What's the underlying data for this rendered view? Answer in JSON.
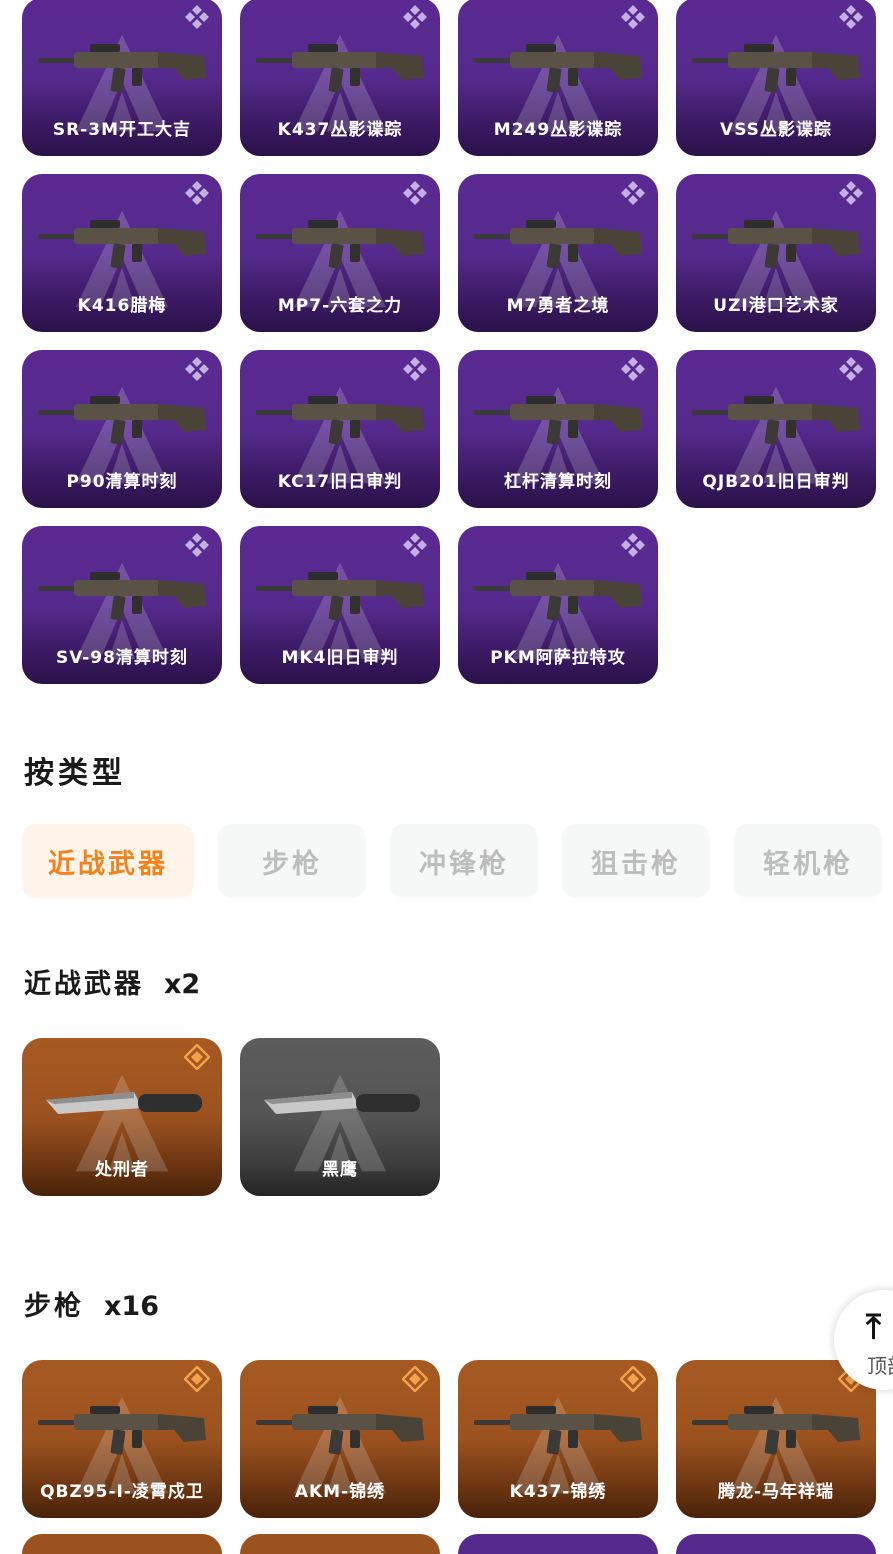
{
  "colors": {
    "purple": "#562a8c",
    "orange": "#9c521f",
    "gray": "#545454",
    "accent": "#f0831d"
  },
  "top_grid": [
    {
      "name": "SR-3M开工大吉",
      "rarity": "purple"
    },
    {
      "name": "K437丛影谍踪",
      "rarity": "purple"
    },
    {
      "name": "M249丛影谍踪",
      "rarity": "purple"
    },
    {
      "name": "VSS丛影谍踪",
      "rarity": "purple"
    },
    {
      "name": "K416腊梅",
      "rarity": "purple"
    },
    {
      "name": "MP7-六套之力",
      "rarity": "purple"
    },
    {
      "name": "M7勇者之境",
      "rarity": "purple"
    },
    {
      "name": "UZI港口艺术家",
      "rarity": "purple"
    },
    {
      "name": "P90清算时刻",
      "rarity": "purple"
    },
    {
      "name": "KC17旧日审判",
      "rarity": "purple"
    },
    {
      "name": "杠杆清算时刻",
      "rarity": "purple"
    },
    {
      "name": "QJB201旧日审判",
      "rarity": "purple"
    },
    {
      "name": "SV-98清算时刻",
      "rarity": "purple"
    },
    {
      "name": "MK4旧日审判",
      "rarity": "purple"
    },
    {
      "name": "PKM阿萨拉特攻",
      "rarity": "purple"
    }
  ],
  "by_type": {
    "title": "按类型",
    "tabs": [
      {
        "label": "近战武器",
        "active": true
      },
      {
        "label": "步枪",
        "active": false
      },
      {
        "label": "冲锋枪",
        "active": false
      },
      {
        "label": "狙击枪",
        "active": false
      },
      {
        "label": "轻机枪",
        "active": false
      }
    ]
  },
  "melee": {
    "title": "近战武器",
    "count": "x2",
    "items": [
      {
        "name": "处刑者",
        "rarity": "orange"
      },
      {
        "name": "黑鹰",
        "rarity": "gray"
      }
    ]
  },
  "rifle": {
    "title": "步枪",
    "count": "x16",
    "items": [
      {
        "name": "QBZ95-I-凌霄戍卫",
        "rarity": "orange"
      },
      {
        "name": "AKM-锦绣",
        "rarity": "orange"
      },
      {
        "name": "K437-锦绣",
        "rarity": "orange"
      },
      {
        "name": "腾龙-马年祥瑞",
        "rarity": "orange"
      }
    ]
  },
  "back_to_top": {
    "label": "顶部",
    "icon": "arrow-up-icon"
  }
}
